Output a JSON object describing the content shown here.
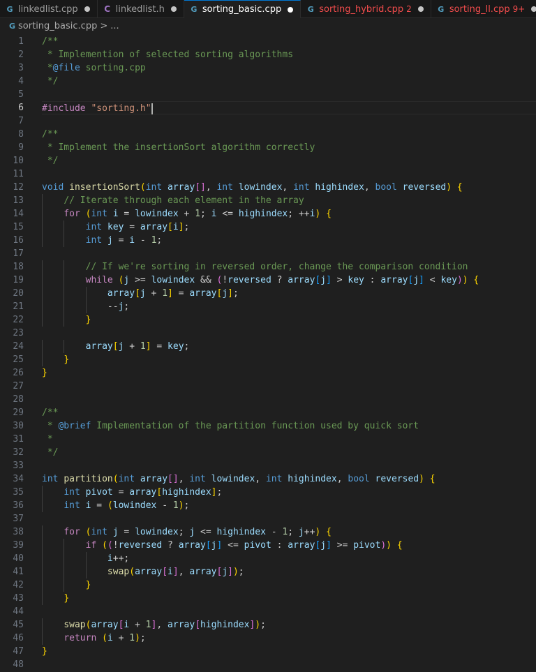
{
  "tabs": [
    {
      "icon": "G",
      "label": "linkedlist.cpp",
      "count": "",
      "state": "modified"
    },
    {
      "icon": "C",
      "label": "linkedlist.h",
      "count": "",
      "state": "modified"
    },
    {
      "icon": "G",
      "label": "sorting_basic.cpp",
      "count": "",
      "state": "active"
    },
    {
      "icon": "G",
      "label": "sorting_hybrid.cpp",
      "count": "2",
      "state": "error"
    },
    {
      "icon": "G",
      "label": "sorting_ll.cpp",
      "count": "9+",
      "state": "error"
    }
  ],
  "breadcrumb": {
    "icon": "G",
    "file": "sorting_basic.cpp",
    "chevron": ">",
    "more": "..."
  },
  "editor": {
    "cursor_line": 6,
    "lines": [
      "/**",
      " * Implemention of selected sorting algorithms",
      " *@file sorting.cpp",
      " */",
      "",
      "#include \"sorting.h\"",
      "",
      "/**",
      " * Implement the insertionSort algorithm correctly",
      " */",
      "",
      "void insertionSort(int array[], int lowindex, int highindex, bool reversed) {",
      "    // Iterate through each element in the array",
      "    for (int i = lowindex + 1; i <= highindex; ++i) {",
      "        int key = array[i];",
      "        int j = i - 1;",
      "",
      "        // If we're sorting in reversed order, change the comparison condition",
      "        while (j >= lowindex && (!reversed ? array[j] > key : array[j] < key)) {",
      "            array[j + 1] = array[j];",
      "            --j;",
      "        }",
      "",
      "        array[j + 1] = key;",
      "    }",
      "}",
      "",
      "",
      "/**",
      " * @brief Implementation of the partition function used by quick sort",
      " *",
      " */",
      "",
      "int partition(int array[], int lowindex, int highindex, bool reversed) {",
      "    int pivot = array[highindex];",
      "    int i = (lowindex - 1);",
      "",
      "    for (int j = lowindex; j <= highindex - 1; j++) {",
      "        if ((!reversed ? array[j] <= pivot : array[j] >= pivot)) {",
      "            i++;",
      "            swap(array[i], array[j]);",
      "        }",
      "    }",
      "",
      "    swap(array[i + 1], array[highindex]);",
      "    return (i + 1);",
      "}",
      ""
    ]
  },
  "colors": {
    "background": "#1f1f1f",
    "comment": "#6a9955",
    "keyword": "#569cd6",
    "control": "#c586c0",
    "function": "#dcdcaa",
    "variable": "#9cdcfe",
    "number": "#b5cea8",
    "string": "#ce9178",
    "error": "#f14c4c",
    "accent": "#0078d4"
  }
}
